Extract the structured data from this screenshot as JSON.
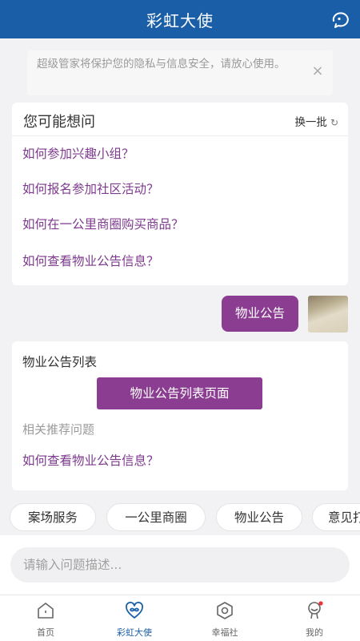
{
  "header": {
    "title": "彩虹大使",
    "chat_icon": "chat-bubble-icon"
  },
  "notice": {
    "text": "超级管家将保护您的隐私与信息安全，请放心使用。",
    "close_icon": "close-icon"
  },
  "faq": {
    "title": "您可能想问",
    "refresh_label": "换一批",
    "refresh_icon": "refresh-icon",
    "questions": [
      "如何参加兴趣小组？",
      "如何报名参加社区活动？",
      "如何在一公里商圈购买商品？",
      "如何查看物业公告信息？"
    ]
  },
  "user_message": {
    "text": "物业公告"
  },
  "reply": {
    "title": "物业公告列表",
    "button_label": "物业公告列表页面",
    "related_label": "相关推荐问题",
    "related_questions": [
      "如何查看物业公告信息？"
    ]
  },
  "chips": [
    "案场服务",
    "一公里商圈",
    "物业公告",
    "意见打"
  ],
  "input": {
    "placeholder": "请输入问题描述..."
  },
  "tabbar": {
    "items": [
      {
        "label": "首页",
        "icon": "home-icon"
      },
      {
        "label": "彩虹大使",
        "icon": "infinity-heart-icon"
      },
      {
        "label": "幸福社",
        "icon": "hexagon-icon"
      },
      {
        "label": "我的",
        "icon": "profile-icon"
      }
    ],
    "active_index": 1
  },
  "colors": {
    "brand_blue": "#1a5ea8",
    "accent_purple": "#8b3d91",
    "link_purple": "#7d3a8e"
  }
}
